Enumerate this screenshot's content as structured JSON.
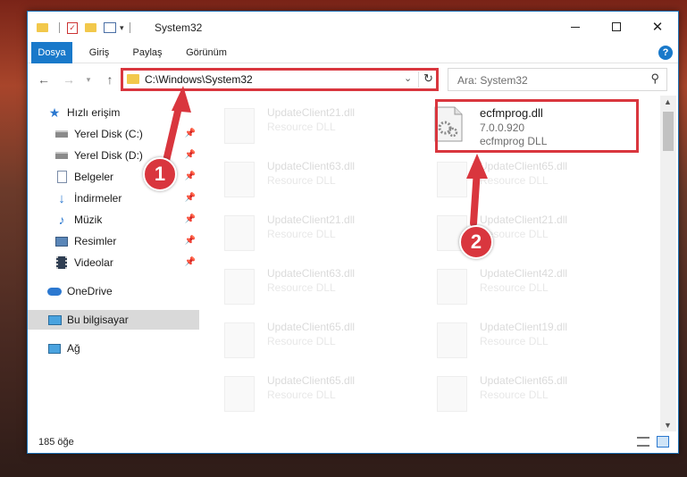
{
  "window": {
    "title": "System32",
    "controls": [
      "minimize",
      "maximize",
      "close"
    ]
  },
  "ribbon": {
    "tabs": [
      "Dosya",
      "Giriş",
      "Paylaş",
      "Görünüm"
    ]
  },
  "nav": {
    "address": "C:\\Windows\\System32",
    "search_placeholder": "Ara: System32"
  },
  "sidebar": {
    "items": [
      {
        "label": "Hızlı erişim",
        "icon": "star-icon"
      },
      {
        "label": "Yerel Disk (C:)",
        "icon": "drive-icon",
        "pinned": true
      },
      {
        "label": "Yerel Disk (D:)",
        "icon": "drive-icon",
        "pinned": true
      },
      {
        "label": "Belgeler",
        "icon": "documents-icon",
        "pinned": true
      },
      {
        "label": "İndirmeler",
        "icon": "download-icon",
        "pinned": true
      },
      {
        "label": "Müzik",
        "icon": "music-icon",
        "pinned": true
      },
      {
        "label": "Resimler",
        "icon": "pictures-icon",
        "pinned": true
      },
      {
        "label": "Videolar",
        "icon": "videos-icon",
        "pinned": true
      },
      {
        "label": "OneDrive",
        "icon": "cloud-icon"
      },
      {
        "label": "Bu bilgisayar",
        "icon": "computer-icon",
        "selected": true
      },
      {
        "label": "Ağ",
        "icon": "network-icon"
      }
    ]
  },
  "files": {
    "highlighted": {
      "name": "ecfmprog.dll",
      "version": "7.0.0.920",
      "description": "ecfmprog DLL"
    },
    "left_column": [
      {
        "name": "UpdateClient21.dll",
        "type": "Resource DLL"
      },
      {
        "name": "UpdateClient63.dll",
        "type": "Resource DLL"
      },
      {
        "name": "UpdateClient21.dll",
        "type": "Resource DLL"
      },
      {
        "name": "UpdateClient63.dll",
        "type": "Resource DLL"
      },
      {
        "name": "UpdateClient65.dll",
        "type": "Resource DLL"
      },
      {
        "name": "UpdateClient65.dll",
        "type": "Resource DLL"
      }
    ],
    "right_column": [
      {
        "name": "UpdateClient65.dll",
        "type": "Resource DLL"
      },
      {
        "name": "UpdateClient21.dll",
        "type": "Resource DLL"
      },
      {
        "name": "UpdateClient42.dll",
        "type": "Resource DLL"
      },
      {
        "name": "UpdateClient19.dll",
        "type": "Resource DLL"
      },
      {
        "name": "UpdateClient65.dll",
        "type": "Resource DLL"
      }
    ]
  },
  "status": {
    "count": "185 öğe"
  },
  "callouts": {
    "one": "1",
    "two": "2",
    "color": "#d9363e"
  }
}
